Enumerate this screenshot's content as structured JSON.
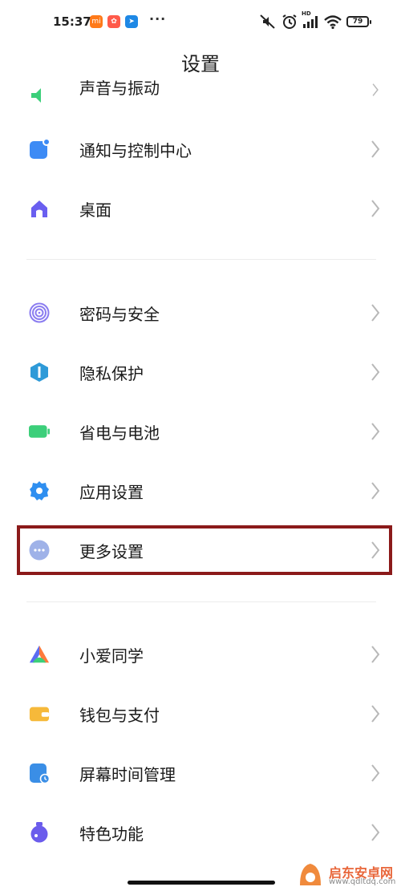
{
  "status_bar": {
    "time": "15:37",
    "battery": "79",
    "network_badge": "HD"
  },
  "header": {
    "title": "设置"
  },
  "partial_item": {
    "label": "声音与振动",
    "icon": "sound-icon"
  },
  "groups": [
    {
      "items": [
        {
          "label": "通知与控制中心",
          "icon": "notification-icon",
          "color": "#3d8bf5"
        },
        {
          "label": "桌面",
          "icon": "home-icon",
          "color": "#6a5ff0"
        }
      ]
    },
    {
      "items": [
        {
          "label": "密码与安全",
          "icon": "fingerprint-icon",
          "color": "#8a7cf0"
        },
        {
          "label": "隐私保护",
          "icon": "privacy-icon",
          "color": "#2e9ad8"
        },
        {
          "label": "省电与电池",
          "icon": "battery-icon",
          "color": "#3ccf7a"
        },
        {
          "label": "应用设置",
          "icon": "gear-icon",
          "color": "#2f8ff0"
        },
        {
          "label": "更多设置",
          "icon": "more-icon",
          "color": "#9fb2e8",
          "highlighted": true
        }
      ]
    },
    {
      "items": [
        {
          "label": "小爱同学",
          "icon": "xiaoai-icon",
          "color": "#ff7a3c"
        },
        {
          "label": "钱包与支付",
          "icon": "wallet-icon",
          "color": "#f6b93a"
        },
        {
          "label": "屏幕时间管理",
          "icon": "screen-time-icon",
          "color": "#3a8ee6"
        },
        {
          "label": "特色功能",
          "icon": "feature-icon",
          "color": "#6b5cec"
        }
      ]
    }
  ],
  "watermark": {
    "title": "启东安卓网",
    "url": "www.qdltdq.com"
  },
  "accent_colors": {
    "highlight_border": "#8b1a1a"
  }
}
